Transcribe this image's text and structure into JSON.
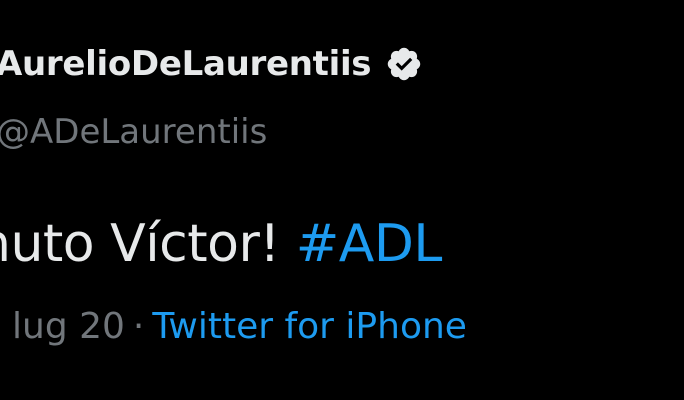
{
  "tweet": {
    "display_name": "AurelioDeLaurentiis",
    "verified_icon": "verified-badge-icon",
    "handle": "@ADeLaurentiis",
    "text_prefix": "nuto Víctor! ",
    "hashtag": "#ADL",
    "date": "lug 20",
    "separator": "·",
    "source": "Twitter for iPhone"
  },
  "colors": {
    "background": "#000000",
    "primary_text": "#e7e9ea",
    "secondary_text": "#71767b",
    "accent": "#1d9bf0"
  }
}
